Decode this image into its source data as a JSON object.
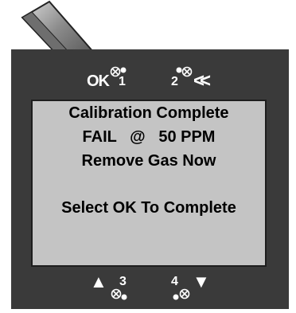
{
  "screen": {
    "line1": "Calibration Complete",
    "line2": "FAIL   @   50 PPM",
    "line3": "Remove Gas Now",
    "line4": "Select OK To Complete"
  },
  "buttons": {
    "top_left": {
      "label": "OK",
      "number": "1",
      "icon": "button-circle-icon"
    },
    "top_right": {
      "label": "<<",
      "number": "2",
      "icon": "button-circle-icon"
    },
    "bottom_left": {
      "label": "▲",
      "number": "3",
      "icon": "button-circle-icon"
    },
    "bottom_right": {
      "label": "▼",
      "number": "4",
      "icon": "button-circle-icon"
    }
  },
  "colors": {
    "device_body": "#3a3a3a",
    "screen_bg": "#c4c4c4",
    "text": "#000000",
    "button_text": "#ffffff"
  }
}
